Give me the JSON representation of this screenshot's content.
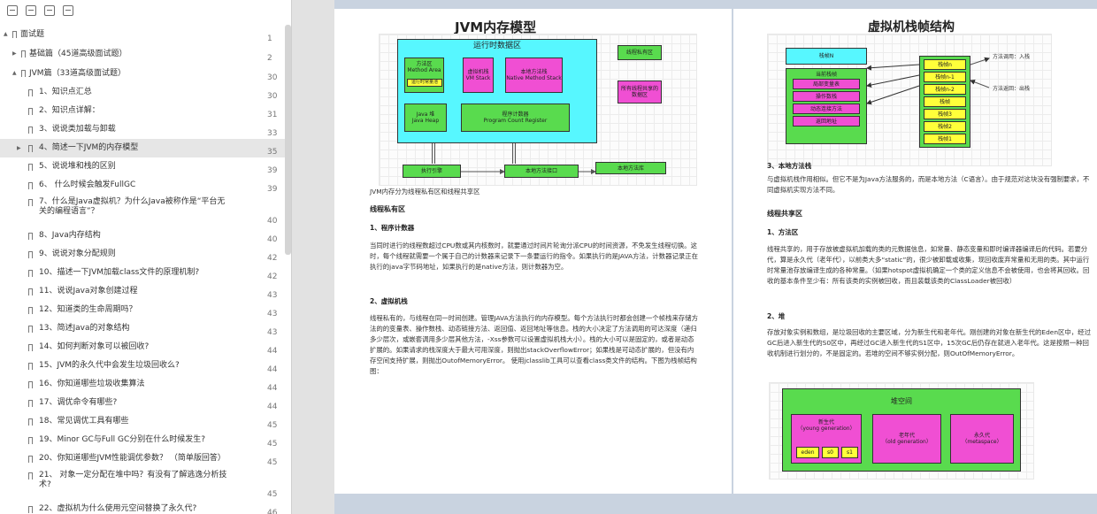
{
  "sidebar": {
    "toc": [
      {
        "label": "面试题",
        "page": "1"
      },
      {
        "label": "基础篇（45道高级面试题）",
        "page": "2"
      },
      {
        "label": "JVM篇（33道高级面试题）",
        "page": "30"
      },
      {
        "label": "1、知识点汇总",
        "page": "30"
      },
      {
        "label": "2、知识点详解：",
        "page": "31"
      },
      {
        "label": "3、说说类加载与卸载",
        "page": "33"
      },
      {
        "label": "4、简述一下JVM的内存模型",
        "page": "35"
      },
      {
        "label": "5、说说堆和栈的区别",
        "page": "39"
      },
      {
        "label": "6、 什么时候会触发FullGC",
        "page": "39"
      },
      {
        "label": "7、什么是Java虚拟机？为什么Java被称作是“平台无关的编程语言”？",
        "page": "40"
      },
      {
        "label": "8、Java内存结构",
        "page": "40"
      },
      {
        "label": "9、说说对象分配规则",
        "page": "42"
      },
      {
        "label": "10、描述一下JVM加载class文件的原理机制?",
        "page": "42"
      },
      {
        "label": "11、说说Java对象创建过程",
        "page": "43"
      },
      {
        "label": "12、知道类的生命周期吗？",
        "page": "43"
      },
      {
        "label": "13、简述Java的对象结构",
        "page": "43"
      },
      {
        "label": "14、如何判断对象可以被回收?",
        "page": "44"
      },
      {
        "label": "15、JVM的永久代中会发生垃圾回收么?",
        "page": "44"
      },
      {
        "label": "16、你知道哪些垃圾收集算法",
        "page": "44"
      },
      {
        "label": "17、调优命令有哪些?",
        "page": "44"
      },
      {
        "label": "18、常见调优工具有哪些",
        "page": "45"
      },
      {
        "label": "19、Minor GC与Full GC分别在什么时候发生?",
        "page": "45"
      },
      {
        "label": "20、你知道哪些JVM性能调优参数？ （简单版回答）",
        "page": "45"
      },
      {
        "label": "21、 对象一定分配在堆中吗？有没有了解逃逸分析技术?",
        "page": "45"
      },
      {
        "label": "22、虚拟机为什么使用元空间替换了永久代?",
        "page": "46"
      }
    ]
  },
  "left_page": {
    "title": "JVM内存模型",
    "diagram": {
      "runtime_area": "运行时数据区",
      "method_area": "方法区\nMethod Area",
      "constant_pool": "运行时常量池",
      "vm_stack": "虚拟机栈\nVM Stack",
      "native_stack": "本地方法栈\nNative Method Stack",
      "heap": "Java 堆\nJava Heap",
      "pc": "程序计数器\nProgram Count Register",
      "legend_private": "线程私有区",
      "legend_shared": "所有线程共享的\n数据区",
      "exec_engine": "执行引擎",
      "native_iface": "本地方法接口",
      "native_lib": "本地方法库"
    },
    "intro": "JVM内存分为线程私有区和线程共享区",
    "h_private": "线程私有区",
    "h_pc": "1、程序计数器",
    "p_pc": "当同时进行的线程数超过CPU数或其内核数时，就要通过时间片轮询分派CPU的时间资源，不免发生线程切换。这时，每个线程就需要一个属于自己的计数器来记录下一条要运行的指令。如果执行的是JAVA方法，计数器记录正在执行的java字节码地址，如果执行的是native方法，则计数器为空。",
    "h_vm": "2、虚拟机栈",
    "p_vm": "线程私有的，与线程在同一时间创建。管理JAVA方法执行的内存模型。每个方法执行时都会创建一个帧栈来存储方法的的变量表、操作数栈、动态链接方法、返回值、返回地址等信息。栈的大小决定了方法调用的可达深度（递归多少层次，或嵌套调用多少层其他方法，-Xss参数可以设置虚拟机栈大小）。栈的大小可以是固定的，或者是动态扩展的。如果请求的栈深度大于最大可用深度，则抛出stackOverflowError；如果栈是可动态扩展的，但没有内存空间支持扩展，则抛出OutofMemoryError。 使用jclasslib工具可以查看class类文件的结构。下图为栈帧结构图："
  },
  "right_page": {
    "title": "虚拟机栈帧结构",
    "diagram": {
      "frame_n": "栈帧N",
      "current_frame": "当前栈帧",
      "local_vars": "局部变量表",
      "operand_stack": "操作数栈",
      "dynamic_link": "动态连接方法",
      "return_addr": "返回地址",
      "stack": [
        "栈帧n",
        "栈帧n-1",
        "栈帧n-2",
        "栈帧",
        "栈帧3",
        "栈帧2",
        "栈帧1"
      ],
      "call_in": "方法调用：入栈",
      "return_out": "方法返回：出栈"
    },
    "h_native": "3、本地方法栈",
    "p_native": "与虚拟机栈作用相似。但它不是为Java方法服务的，而是本地方法（C语言）。由于规范对这块没有强制要求，不同虚拟机实现方法不同。",
    "h_shared": "线程共享区",
    "h_method": "1、方法区",
    "p_method": "线程共享的，用于存放被虚拟机加载的类的元数据信息，如常量、静态变量和即时编译器编译后的代码。若要分代，算是永久代（老年代），以前类大多“static”的，很少被卸载或收集，现回收废弃常量和无用的类。其中运行时常量池存放编译生成的各种常量。（如果hotspot虚拟机确定一个类的定义信息不会被使用，也会将其回收。回收的基本条件至少有：所有该类的实例被回收，而且装载该类的ClassLoader被回收）",
    "h_heap": "2、堆",
    "p_heap": "存放对象实例和数组，是垃圾回收的主要区域，分为新生代和老年代。刚创建的对象在新生代的Eden区中，经过GC后进入新生代的S0区中，再经过GC进入新生代的S1区中，15次GC后仍存在就进入老年代。这是按照一种回收机制进行划分的，不是固定的。若堆的空间不够实例分配，则OutOfMemoryError。",
    "heap_diagram": {
      "heap_space": "堆空间",
      "young": "新生代\n（young generation）",
      "eden": "eden",
      "s0": "s0",
      "s1": "s1",
      "old": "老年代\n（old generation）",
      "meta": "永久代\n（metaspace）"
    }
  }
}
